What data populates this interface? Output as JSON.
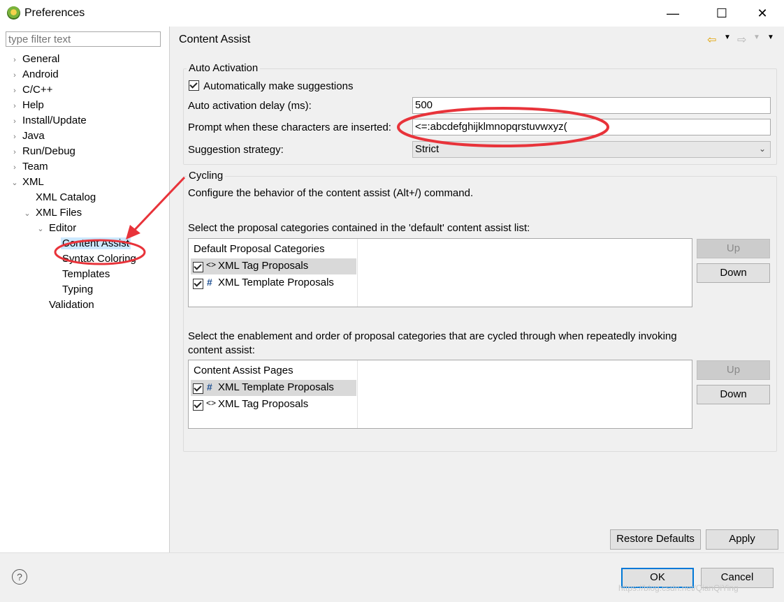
{
  "window": {
    "title": "Preferences",
    "minimize": "—",
    "maximize": "☐",
    "close": "✕"
  },
  "filter": {
    "placeholder": "type filter text"
  },
  "tree": {
    "general": "General",
    "android": "Android",
    "ccpp": "C/C++",
    "help": "Help",
    "install": "Install/Update",
    "java": "Java",
    "rundebug": "Run/Debug",
    "team": "Team",
    "xml": "XML",
    "xml_catalog": "XML Catalog",
    "xml_files": "XML Files",
    "editor": "Editor",
    "content_assist": "Content Assist",
    "syntax_coloring": "Syntax Coloring",
    "templates": "Templates",
    "typing": "Typing",
    "validation": "Validation"
  },
  "page": {
    "title": "Content Assist"
  },
  "auto_activation": {
    "group_label": "Auto Activation",
    "auto_suggest_label": "Automatically make suggestions",
    "delay_label": "Auto activation delay (ms):",
    "delay_value": "500",
    "prompt_label": "Prompt when these characters are inserted:",
    "prompt_value": "<=:abcdefghijklmnopqrstuvwxyz(",
    "strategy_label": "Suggestion strategy:",
    "strategy_value": "Strict"
  },
  "cycling": {
    "group_label": "Cycling",
    "description": "Configure the behavior of the content assist (Alt+/) command.",
    "default_list_label": "Select the proposal categories contained in the 'default' content assist list:",
    "default_header": "Default Proposal Categories",
    "default_rows": [
      "XML Tag Proposals",
      "XML Template Proposals"
    ],
    "cycle_label_line1": "Select the enablement and order of proposal categories that are cycled through when repeatedly invoking",
    "cycle_label_line2": "content assist:",
    "pages_header": "Content Assist Pages",
    "pages_rows": [
      "XML Template Proposals",
      "XML Tag Proposals"
    ],
    "up_label": "Up",
    "down_label": "Down"
  },
  "buttons": {
    "restore": "Restore Defaults",
    "apply": "Apply",
    "ok": "OK",
    "cancel": "Cancel"
  },
  "icons": {
    "tag": "<>",
    "template": "#",
    "help": "?"
  },
  "watermark": "https://blog.csdn.net/QianQiYing",
  "colors": {
    "selection": "#cce8ff",
    "annotation": "#e8333a",
    "default_button": "#0078d7"
  }
}
